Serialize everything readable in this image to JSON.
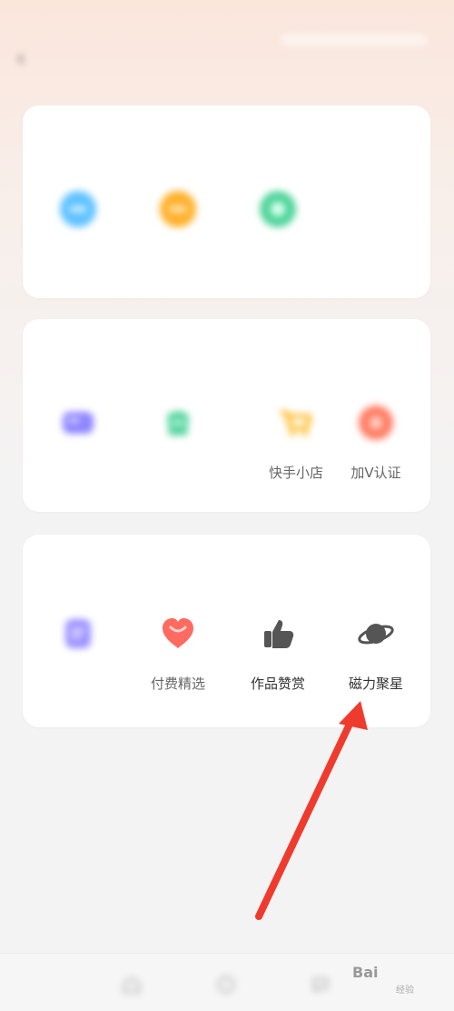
{
  "header": {
    "title": "",
    "back_icon": "chevron-left-icon"
  },
  "sections": [
    {
      "title": "",
      "items": [
        {
          "label": "",
          "icon": "blue-circle-icon",
          "color": "#61c3ff"
        },
        {
          "label": "",
          "icon": "orange-circle-icon",
          "color": "#ffb12b"
        },
        {
          "label": "",
          "icon": "green-circle-icon",
          "color": "#4fd49a"
        }
      ]
    },
    {
      "title": "",
      "items": [
        {
          "label": "",
          "icon": "purple-card-icon",
          "color": "#8e84ff"
        },
        {
          "label": "",
          "icon": "green-bag-icon",
          "color": "#58d4a0"
        },
        {
          "label": "快手小店",
          "icon": "yellow-cart-icon",
          "color": "#ffbd2d"
        },
        {
          "label": "加V认证",
          "icon": "red-badge-icon",
          "color": "#ff7d63"
        }
      ]
    },
    {
      "title": "",
      "items": [
        {
          "label": "",
          "icon": "purple-document-icon",
          "color": "#9a90ff"
        },
        {
          "label": "付费精选",
          "icon": "red-heart-icon",
          "color": "#ff6b61"
        },
        {
          "label": "作品赞赏",
          "icon": "thumbs-up-icon",
          "color": "#555555"
        },
        {
          "label": "磁力聚星",
          "icon": "planet-icon",
          "color": "#555555"
        }
      ]
    }
  ],
  "bottom_nav": {
    "icons": [
      "home-icon",
      "discover-icon",
      "message-icon"
    ]
  },
  "watermark": {
    "text": "Bai",
    "subtext": "经验"
  },
  "annotation": {
    "color": "#ef3b2d"
  }
}
